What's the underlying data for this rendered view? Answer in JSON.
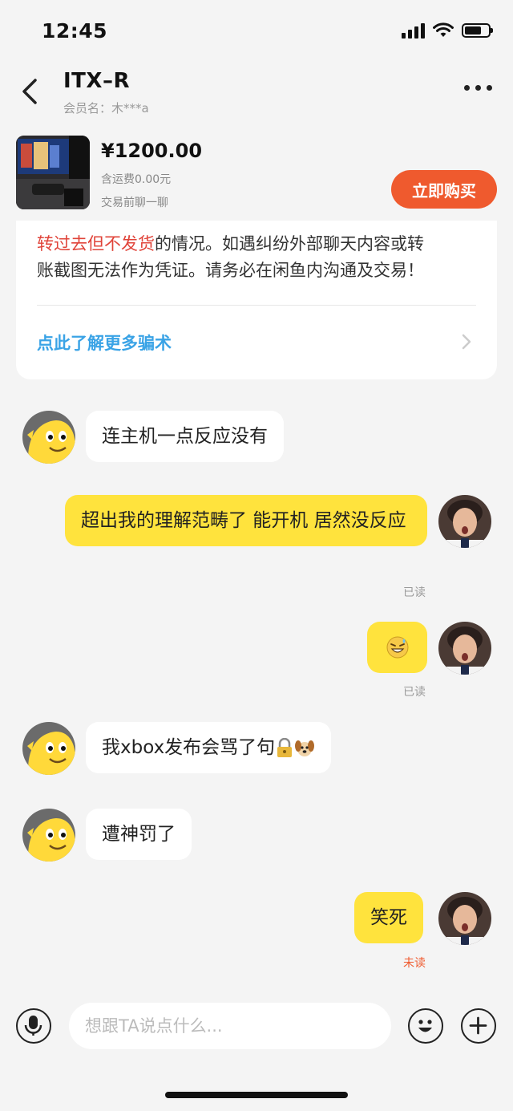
{
  "status_bar": {
    "time": "12:45"
  },
  "header": {
    "title": "ITX–R",
    "member": "会员名：木***a"
  },
  "product": {
    "price": "¥1200.00",
    "shipping": "含运费0.00元",
    "note": "交易前聊一聊",
    "buy_label": "立即购买"
  },
  "warning": {
    "line1_red": "转过去但不发货",
    "line1_rest": "的情况。如遇纠纷外部聊天内容或转",
    "line2": "账截图无法作为凭证。请务必在闲鱼内沟通及交易！",
    "learn_more": "点此了解更多骗术"
  },
  "messages": [
    {
      "side": "left",
      "text": "连主机一点反应没有"
    },
    {
      "side": "right",
      "text": "超出我的理解范畴了 能开机 居然没反应",
      "status": "已读"
    },
    {
      "side": "right",
      "emoji": "grinning-sweat-face",
      "status": "已读"
    },
    {
      "side": "left",
      "text": "我xbox发布会骂了句",
      "emojis": [
        "lock",
        "dog-face"
      ]
    },
    {
      "side": "left",
      "text": "遭神罚了"
    },
    {
      "side": "right",
      "text": "笑死",
      "status": "未读"
    }
  ],
  "input": {
    "placeholder": "想跟TA说点什么..."
  },
  "colors": {
    "accent": "#ef5a2e",
    "bubble_self": "#ffe33d",
    "link": "#3aa3e6",
    "warning": "#e0443a"
  }
}
